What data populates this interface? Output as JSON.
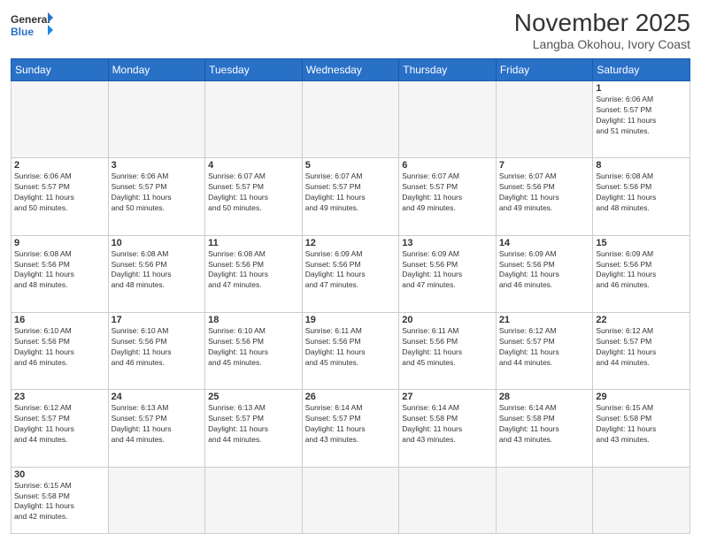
{
  "header": {
    "logo_general": "General",
    "logo_blue": "Blue",
    "month_year": "November 2025",
    "location": "Langba Okohou, Ivory Coast"
  },
  "days_of_week": [
    "Sunday",
    "Monday",
    "Tuesday",
    "Wednesday",
    "Thursday",
    "Friday",
    "Saturday"
  ],
  "weeks": [
    [
      {
        "day": "",
        "info": ""
      },
      {
        "day": "",
        "info": ""
      },
      {
        "day": "",
        "info": ""
      },
      {
        "day": "",
        "info": ""
      },
      {
        "day": "",
        "info": ""
      },
      {
        "day": "",
        "info": ""
      },
      {
        "day": "1",
        "info": "Sunrise: 6:06 AM\nSunset: 5:57 PM\nDaylight: 11 hours\nand 51 minutes."
      }
    ],
    [
      {
        "day": "2",
        "info": "Sunrise: 6:06 AM\nSunset: 5:57 PM\nDaylight: 11 hours\nand 50 minutes."
      },
      {
        "day": "3",
        "info": "Sunrise: 6:06 AM\nSunset: 5:57 PM\nDaylight: 11 hours\nand 50 minutes."
      },
      {
        "day": "4",
        "info": "Sunrise: 6:07 AM\nSunset: 5:57 PM\nDaylight: 11 hours\nand 50 minutes."
      },
      {
        "day": "5",
        "info": "Sunrise: 6:07 AM\nSunset: 5:57 PM\nDaylight: 11 hours\nand 49 minutes."
      },
      {
        "day": "6",
        "info": "Sunrise: 6:07 AM\nSunset: 5:57 PM\nDaylight: 11 hours\nand 49 minutes."
      },
      {
        "day": "7",
        "info": "Sunrise: 6:07 AM\nSunset: 5:56 PM\nDaylight: 11 hours\nand 49 minutes."
      },
      {
        "day": "8",
        "info": "Sunrise: 6:08 AM\nSunset: 5:56 PM\nDaylight: 11 hours\nand 48 minutes."
      }
    ],
    [
      {
        "day": "9",
        "info": "Sunrise: 6:08 AM\nSunset: 5:56 PM\nDaylight: 11 hours\nand 48 minutes."
      },
      {
        "day": "10",
        "info": "Sunrise: 6:08 AM\nSunset: 5:56 PM\nDaylight: 11 hours\nand 48 minutes."
      },
      {
        "day": "11",
        "info": "Sunrise: 6:08 AM\nSunset: 5:56 PM\nDaylight: 11 hours\nand 47 minutes."
      },
      {
        "day": "12",
        "info": "Sunrise: 6:09 AM\nSunset: 5:56 PM\nDaylight: 11 hours\nand 47 minutes."
      },
      {
        "day": "13",
        "info": "Sunrise: 6:09 AM\nSunset: 5:56 PM\nDaylight: 11 hours\nand 47 minutes."
      },
      {
        "day": "14",
        "info": "Sunrise: 6:09 AM\nSunset: 5:56 PM\nDaylight: 11 hours\nand 46 minutes."
      },
      {
        "day": "15",
        "info": "Sunrise: 6:09 AM\nSunset: 5:56 PM\nDaylight: 11 hours\nand 46 minutes."
      }
    ],
    [
      {
        "day": "16",
        "info": "Sunrise: 6:10 AM\nSunset: 5:56 PM\nDaylight: 11 hours\nand 46 minutes."
      },
      {
        "day": "17",
        "info": "Sunrise: 6:10 AM\nSunset: 5:56 PM\nDaylight: 11 hours\nand 46 minutes."
      },
      {
        "day": "18",
        "info": "Sunrise: 6:10 AM\nSunset: 5:56 PM\nDaylight: 11 hours\nand 45 minutes."
      },
      {
        "day": "19",
        "info": "Sunrise: 6:11 AM\nSunset: 5:56 PM\nDaylight: 11 hours\nand 45 minutes."
      },
      {
        "day": "20",
        "info": "Sunrise: 6:11 AM\nSunset: 5:56 PM\nDaylight: 11 hours\nand 45 minutes."
      },
      {
        "day": "21",
        "info": "Sunrise: 6:12 AM\nSunset: 5:57 PM\nDaylight: 11 hours\nand 44 minutes."
      },
      {
        "day": "22",
        "info": "Sunrise: 6:12 AM\nSunset: 5:57 PM\nDaylight: 11 hours\nand 44 minutes."
      }
    ],
    [
      {
        "day": "23",
        "info": "Sunrise: 6:12 AM\nSunset: 5:57 PM\nDaylight: 11 hours\nand 44 minutes."
      },
      {
        "day": "24",
        "info": "Sunrise: 6:13 AM\nSunset: 5:57 PM\nDaylight: 11 hours\nand 44 minutes."
      },
      {
        "day": "25",
        "info": "Sunrise: 6:13 AM\nSunset: 5:57 PM\nDaylight: 11 hours\nand 44 minutes."
      },
      {
        "day": "26",
        "info": "Sunrise: 6:14 AM\nSunset: 5:57 PM\nDaylight: 11 hours\nand 43 minutes."
      },
      {
        "day": "27",
        "info": "Sunrise: 6:14 AM\nSunset: 5:58 PM\nDaylight: 11 hours\nand 43 minutes."
      },
      {
        "day": "28",
        "info": "Sunrise: 6:14 AM\nSunset: 5:58 PM\nDaylight: 11 hours\nand 43 minutes."
      },
      {
        "day": "29",
        "info": "Sunrise: 6:15 AM\nSunset: 5:58 PM\nDaylight: 11 hours\nand 43 minutes."
      }
    ],
    [
      {
        "day": "30",
        "info": "Sunrise: 6:15 AM\nSunset: 5:58 PM\nDaylight: 11 hours\nand 42 minutes."
      },
      {
        "day": "",
        "info": ""
      },
      {
        "day": "",
        "info": ""
      },
      {
        "day": "",
        "info": ""
      },
      {
        "day": "",
        "info": ""
      },
      {
        "day": "",
        "info": ""
      },
      {
        "day": "",
        "info": ""
      }
    ]
  ]
}
